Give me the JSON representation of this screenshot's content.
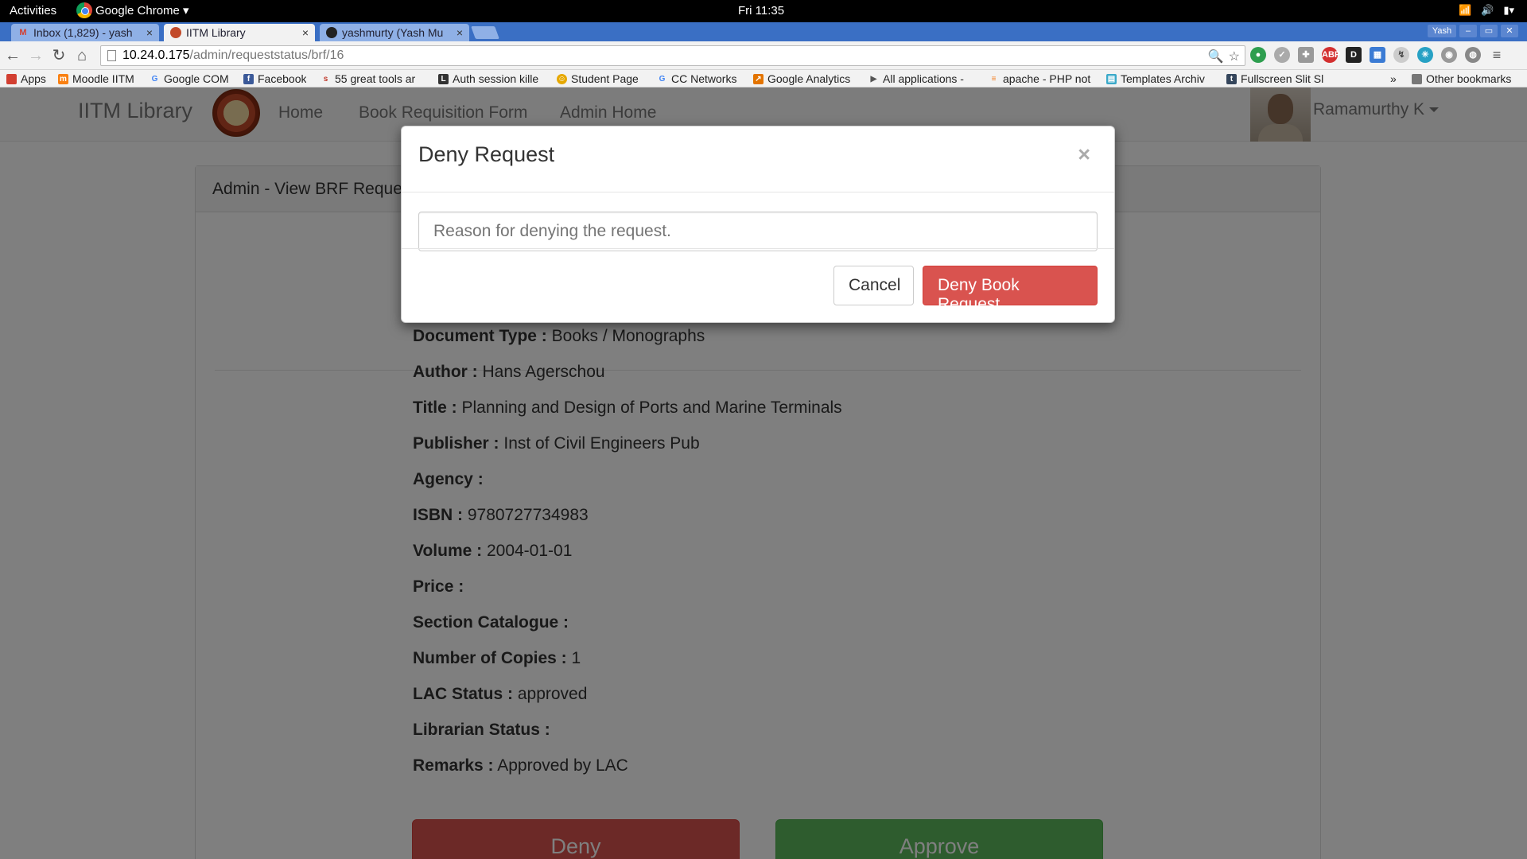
{
  "system_bar": {
    "activities": "Activities",
    "app_menu": "Google Chrome ▾",
    "clock": "Fri 11:35",
    "indicators": [
      "wifi-icon",
      "volume-icon",
      "battery-icon"
    ]
  },
  "tabs": [
    {
      "title": "Inbox (1,829) - yash",
      "icon": "gmail-icon",
      "active": false
    },
    {
      "title": "IITM Library",
      "icon": "library-favicon",
      "active": true
    },
    {
      "title": "yashmurty (Yash Mu",
      "icon": "github-icon",
      "active": false
    }
  ],
  "window": {
    "profile": "Yash"
  },
  "toolbar": {
    "url_host": "10.24.0.175",
    "url_path": "/admin/requeststatus/brf/16"
  },
  "bookmarks": [
    {
      "label": "Apps",
      "icon": "apps-icon",
      "color": "#d23f31"
    },
    {
      "label": "Moodle IITM",
      "icon": "moodle-icon",
      "color": "#f98012"
    },
    {
      "label": "Google COM",
      "icon": "google-icon",
      "color": "#4285f4"
    },
    {
      "label": "Facebook",
      "icon": "facebook-icon",
      "color": "#3b5998"
    },
    {
      "label": "55 great tools ar",
      "icon": "article-icon",
      "color": "#c0392b"
    },
    {
      "label": "Auth session kille",
      "icon": "laravel-icon",
      "color": "#333333"
    },
    {
      "label": "Student Page",
      "icon": "smiley-icon",
      "color": "#e6a800"
    },
    {
      "label": "CC Networks",
      "icon": "google-icon",
      "color": "#4285f4"
    },
    {
      "label": "Google Analytics",
      "icon": "analytics-icon",
      "color": "#e37400"
    },
    {
      "label": "All applications -",
      "icon": "play-icon",
      "color": "#555555"
    },
    {
      "label": "apache - PHP not",
      "icon": "stackoverflow-icon",
      "color": "#f48024"
    },
    {
      "label": "Templates Archiv",
      "icon": "templates-icon",
      "color": "#3aa9c9"
    },
    {
      "label": "Fullscreen Slit Sl",
      "icon": "tumblr-icon",
      "color": "#35465c"
    },
    {
      "label": "Other bookmarks",
      "icon": "folder-icon",
      "color": "#777777"
    }
  ],
  "navbar": {
    "brand": "IITM Library",
    "links": [
      "Home",
      "Book Requisition Form",
      "Admin Home"
    ],
    "user": "Ramamurthy K"
  },
  "panel": {
    "heading": "Admin - View BRF Request"
  },
  "details": [
    {
      "label": "Document Type :",
      "value": "Books / Monographs"
    },
    {
      "label": "Author :",
      "value": "Hans Agerschou"
    },
    {
      "label": "Title :",
      "value": "Planning and Design of Ports and Marine Terminals"
    },
    {
      "label": "Publisher :",
      "value": "Inst of Civil Engineers Pub"
    },
    {
      "label": "Agency :",
      "value": ""
    },
    {
      "label": "ISBN :",
      "value": "9780727734983"
    },
    {
      "label": "Volume :",
      "value": "2004-01-01"
    },
    {
      "label": "Price :",
      "value": ""
    },
    {
      "label": "Section Catalogue :",
      "value": ""
    },
    {
      "label": "Number of Copies :",
      "value": "1"
    },
    {
      "label": "LAC Status :",
      "value": "approved"
    },
    {
      "label": "Librarian Status :",
      "value": ""
    },
    {
      "label": "Remarks :",
      "value": "Approved by LAC"
    }
  ],
  "actions": {
    "deny": "Deny",
    "approve": "Approve"
  },
  "modal": {
    "title": "Deny Request",
    "close": "×",
    "reason_placeholder": "Reason for denying the request.",
    "reason_value": "",
    "cancel": "Cancel",
    "confirm": "Deny Book Request"
  }
}
